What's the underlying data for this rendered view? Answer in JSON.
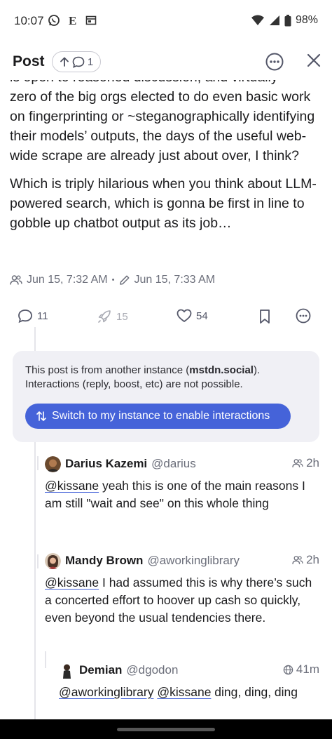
{
  "status_bar": {
    "time": "10:07",
    "battery": "98%"
  },
  "header": {
    "title": "Post",
    "reply_count": "1"
  },
  "post": {
    "partial_line": "is open to reasoned discussion, and virtually",
    "paragraph1": "zero of the big orgs elected to do even basic work on fingerprinting or ~steganographically identifying their models’ outputs, the days of the useful web-wide scrape are already just about over, I think?",
    "paragraph2": "Which is triply hilarious when you think about LLM-powered search, which is gonna be first in line to gobble up chatbot output as its job…",
    "posted_at": "Jun 15, 7:32 AM",
    "separator": "•",
    "edited_at": "Jun 15, 7:33 AM",
    "actions": {
      "replies": "11",
      "boosts": "15",
      "favorites": "54"
    }
  },
  "notice": {
    "text_before": "This post is from another instance (",
    "instance": "mstdn.social",
    "text_after": "). Interactions (reply, boost, etc) are not possible.",
    "button_label": "Switch to my instance to enable interactions"
  },
  "replies": [
    {
      "name": "Darius Kazemi",
      "handle": "@darius",
      "time": "2h",
      "mention": "@kissane",
      "text": " yeah this is one of the main reasons I am still \"wait and see\" on this whole thing"
    },
    {
      "name": "Mandy Brown",
      "handle": "@aworkinglibrary",
      "time": "2h",
      "mention": "@kissane",
      "text": " I had assumed this is why there’s such a concerted effort to hoover up cash so quickly, even beyond the usual tendencies there."
    },
    {
      "name": "Demian",
      "handle": "@dgodon",
      "time": "41m",
      "mention1": "@aworkinglibrary",
      "mention2": "@kissane",
      "text": " ding, ding, ding"
    }
  ],
  "colors": {
    "accent": "#4563d9",
    "notice_bg": "#f0f0f5",
    "muted": "#6b6e7a"
  }
}
